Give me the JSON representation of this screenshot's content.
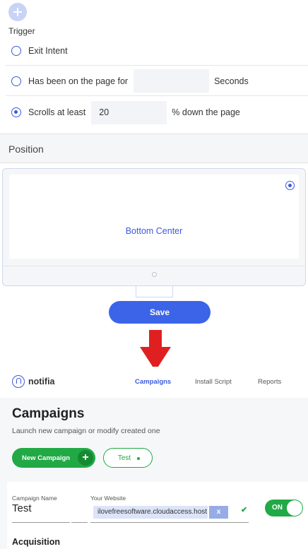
{
  "trigger": {
    "label": "Trigger",
    "options": [
      {
        "label": "Exit Intent",
        "checked": false
      },
      {
        "label": "Has been on the page for",
        "checked": false,
        "input_value": "",
        "suffix": "Seconds"
      },
      {
        "label": "Scrolls at least",
        "checked": true,
        "input_value": "20",
        "suffix": "% down the page"
      }
    ]
  },
  "position": {
    "heading": "Position",
    "selected": "Bottom Center"
  },
  "save_label": "Save",
  "arrow_color": "#e02020",
  "app": {
    "logo": "notifia",
    "nav": [
      "Campaigns",
      "Install Script",
      "Reports"
    ],
    "active_nav": "Campaigns",
    "title": "Campaigns",
    "subtitle": "Launch new campaign or modify created one",
    "new_campaign_label": "New Campaign",
    "test_label": "Test",
    "form": {
      "campaign_name_label": "Campaign Name",
      "campaign_name": "Test",
      "website_label": "Your Website",
      "website": "ilovefreesoftware.cloudaccess.host",
      "remove": "x",
      "toggle": "ON",
      "section": "Acquisition"
    }
  },
  "colors": {
    "accent": "#3b5bdb",
    "button_blue": "#3b64e8",
    "green": "#21a945"
  }
}
